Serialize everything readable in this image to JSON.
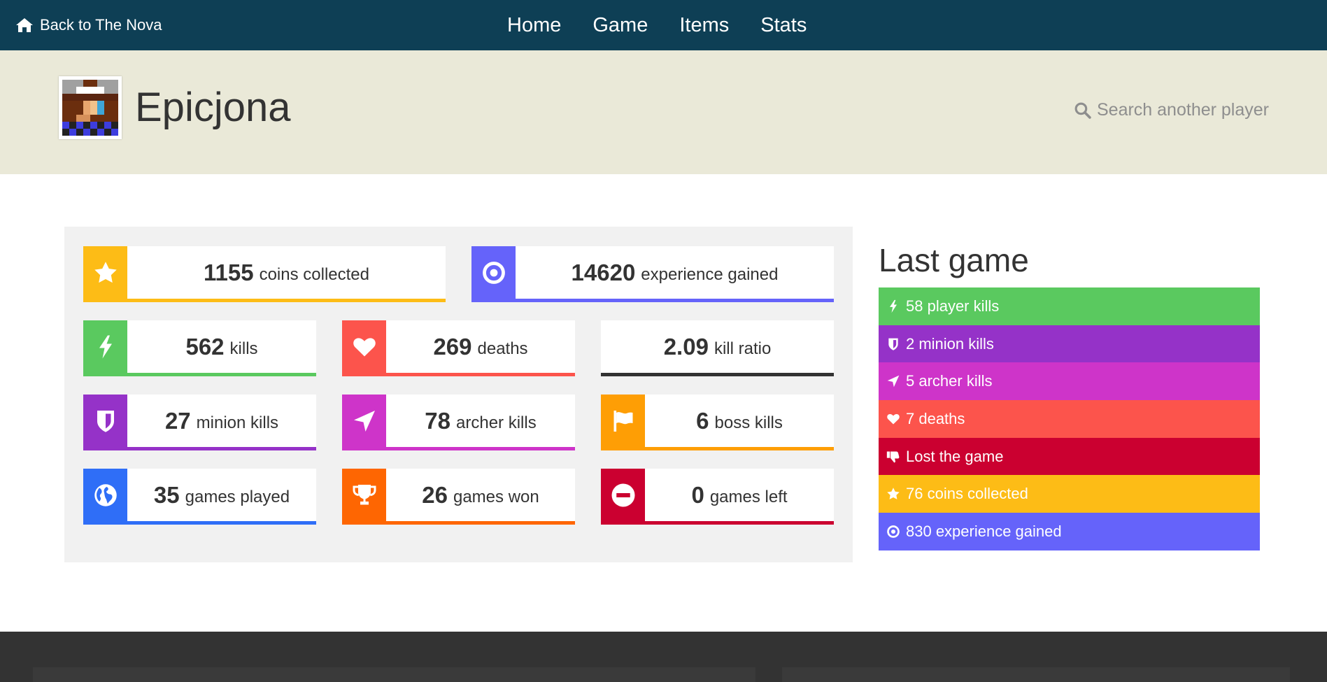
{
  "topbar": {
    "back_label": "Back to The Nova",
    "nav": [
      "Home",
      "Game",
      "Items",
      "Stats"
    ]
  },
  "profile": {
    "name": "Epicjona",
    "search_placeholder": "Search another player"
  },
  "stats": {
    "coins": {
      "value": "1155",
      "label": "coins collected",
      "color": "#fdbc16",
      "icon": "star-icon"
    },
    "experience": {
      "value": "14620",
      "label": "experience gained",
      "color": "#6563fa",
      "icon": "target-icon"
    },
    "kills": {
      "value": "562",
      "label": "kills",
      "color": "#5ac95f",
      "icon": "bolt-icon"
    },
    "deaths": {
      "value": "269",
      "label": "deaths",
      "color": "#fc544c",
      "icon": "heart-icon"
    },
    "kill_ratio": {
      "value": "2.09",
      "label": "kill ratio",
      "color": "#333333"
    },
    "minion_kills": {
      "value": "27",
      "label": "minion kills",
      "color": "#9532c8",
      "icon": "shield-icon"
    },
    "archer_kills": {
      "value": "78",
      "label": "archer kills",
      "color": "#ce34c9",
      "icon": "location-arrow-icon"
    },
    "boss_kills": {
      "value": "6",
      "label": "boss kills",
      "color": "#fe9e05",
      "icon": "flag-icon"
    },
    "games_played": {
      "value": "35",
      "label": "games played",
      "color": "#2f6ef7",
      "icon": "globe-icon"
    },
    "games_won": {
      "value": "26",
      "label": "games won",
      "color": "#fe6602",
      "icon": "trophy-icon"
    },
    "games_left": {
      "value": "0",
      "label": "games left",
      "color": "#cb0030",
      "icon": "minus-circle-icon"
    }
  },
  "last_game": {
    "title": "Last game",
    "items": [
      {
        "text": "58 player kills",
        "color": "#5ac95f",
        "icon": "bolt-icon"
      },
      {
        "text": "2 minion kills",
        "color": "#9532c8",
        "icon": "shield-icon"
      },
      {
        "text": "5 archer kills",
        "color": "#ce34c9",
        "icon": "location-arrow-icon"
      },
      {
        "text": "7 deaths",
        "color": "#fc544c",
        "icon": "heart-icon"
      },
      {
        "text": "Lost the game",
        "color": "#cb0030",
        "icon": "thumbs-down-icon"
      },
      {
        "text": "76 coins collected",
        "color": "#fdbc16",
        "icon": "star-icon"
      },
      {
        "text": "830 experience gained",
        "color": "#6563fa",
        "icon": "target-icon"
      }
    ]
  }
}
